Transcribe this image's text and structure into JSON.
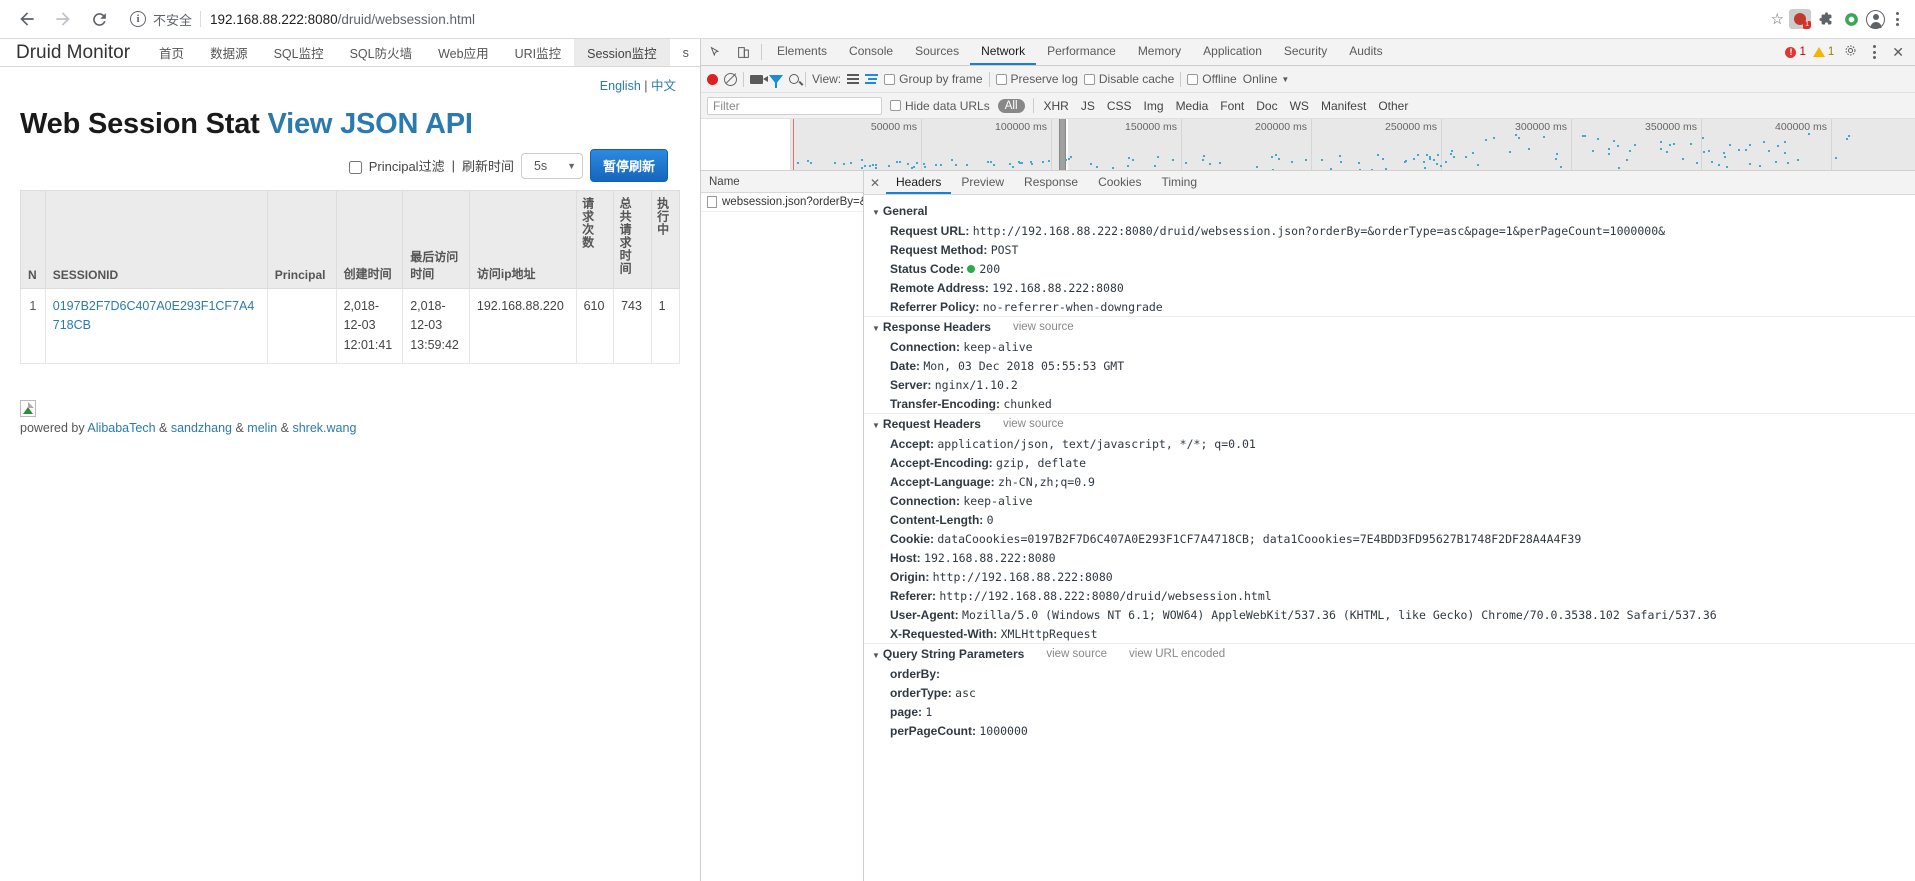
{
  "browser": {
    "back_icon": "back-arrow-icon",
    "forward_icon": "forward-arrow-icon",
    "reload_icon": "reload-icon",
    "security_label": "不安全",
    "url_host": "192.168.88.222:8080",
    "url_path": "/druid/websession.html",
    "url_full": "192.168.88.222:8080/druid/websession.html",
    "star_glyph": "☆",
    "ext_badge_count": "1",
    "profile_icon": "avatar-icon",
    "menu_icon": "kebab-menu-icon"
  },
  "druid": {
    "brand": "Druid Monitor",
    "tabs": [
      {
        "label": "首页",
        "active": false
      },
      {
        "label": "数据源",
        "active": false
      },
      {
        "label": "SQL监控",
        "active": false
      },
      {
        "label": "SQL防火墙",
        "active": false
      },
      {
        "label": "Web应用",
        "active": false
      },
      {
        "label": "URI监控",
        "active": false
      },
      {
        "label": "Session监控",
        "active": true
      },
      {
        "label": "s",
        "active": false
      }
    ],
    "lang": {
      "english": "English",
      "sep": " | ",
      "chinese": "中文"
    },
    "title": "Web Session Stat",
    "title_link": "View JSON API",
    "controls": {
      "principal_filter": "Principal过滤",
      "sep": "|",
      "refresh_label": "刷新时间",
      "refresh_value": "5s",
      "caret": "▼",
      "pause_button": "暂停刷新"
    },
    "table": {
      "headers": [
        "N",
        "SESSIONID",
        "Principal",
        "创建时间",
        "最后访问时间",
        "访问ip地址",
        "请求次数",
        "总共请求时间",
        "执行中"
      ],
      "rows": [
        {
          "n": "1",
          "sessionid": "0197B2F7D6C407A0E293F1CF7A4718CB",
          "principal": "",
          "create_time": "2,018-12-03 12:01:41",
          "last_access": "2,018-12-03 13:59:42",
          "ip": "192.168.88.220",
          "req_count": "610",
          "req_time": "743",
          "running": "1"
        }
      ]
    },
    "footer": {
      "powered_by": "powered by ",
      "links": [
        "AlibabaTech",
        "sandzhang",
        "melin",
        "shrek.wang"
      ],
      "amp": " & "
    }
  },
  "devtools": {
    "inspect_icon": "inspect-element-icon",
    "device_icon": "device-toolbar-icon",
    "tabs": [
      {
        "label": "Elements",
        "active": false
      },
      {
        "label": "Console",
        "active": false
      },
      {
        "label": "Sources",
        "active": false
      },
      {
        "label": "Network",
        "active": true
      },
      {
        "label": "Performance",
        "active": false
      },
      {
        "label": "Memory",
        "active": false
      },
      {
        "label": "Application",
        "active": false
      },
      {
        "label": "Security",
        "active": false
      },
      {
        "label": "Audits",
        "active": false
      }
    ],
    "error_count": "1",
    "warning_count": "1",
    "settings_icon": "gear-icon",
    "more_icon": "kebab-menu-icon",
    "close_icon": "close-icon",
    "toolbar": {
      "record_icon": "record-button-icon",
      "clear_icon": "clear-icon",
      "camera_icon": "capture-screenshots-icon",
      "filter_icon": "filter-funnel-icon",
      "search_icon": "search-icon",
      "view_label": "View:",
      "list_view_icon": "list-view-icon",
      "waterfall_view_icon": "waterfall-view-icon",
      "group_by_frame": "Group by frame",
      "preserve_log": "Preserve log",
      "disable_cache": "Disable cache",
      "offline": "Offline",
      "throttling": "Online",
      "throttle_caret": "▼"
    },
    "filterbar": {
      "filter_placeholder": "Filter",
      "hide_data_urls": "Hide data URLs",
      "all_pill": "All",
      "types": [
        "XHR",
        "JS",
        "CSS",
        "Img",
        "Media",
        "Font",
        "Doc",
        "WS",
        "Manifest",
        "Other"
      ]
    },
    "overview": {
      "ticks": [
        "50000 ms",
        "100000 ms",
        "150000 ms",
        "200000 ms",
        "250000 ms",
        "300000 ms",
        "350000 ms",
        "400000 ms"
      ]
    },
    "requests": {
      "column_header": "Name",
      "items": [
        {
          "name": "websession.json?orderBy=&or...",
          "icon": "document-icon"
        }
      ]
    },
    "detail_tabs": [
      {
        "label": "Headers",
        "active": true
      },
      {
        "label": "Preview",
        "active": false
      },
      {
        "label": "Response",
        "active": false
      },
      {
        "label": "Cookies",
        "active": false
      },
      {
        "label": "Timing",
        "active": false
      }
    ],
    "headers": {
      "general": {
        "title": "General",
        "rows": [
          {
            "key": "Request URL:",
            "value": "http://192.168.88.222:8080/druid/websession.json?orderBy=&orderType=asc&page=1&perPageCount=1000000&"
          },
          {
            "key": "Request Method:",
            "value": "POST"
          },
          {
            "key": "Status Code:",
            "value": "200",
            "status": true
          },
          {
            "key": "Remote Address:",
            "value": "192.168.88.222:8080"
          },
          {
            "key": "Referrer Policy:",
            "value": "no-referrer-when-downgrade"
          }
        ]
      },
      "response": {
        "title": "Response Headers",
        "view_source": "view source",
        "rows": [
          {
            "key": "Connection:",
            "value": "keep-alive"
          },
          {
            "key": "Date:",
            "value": "Mon, 03 Dec 2018 05:55:53 GMT"
          },
          {
            "key": "Server:",
            "value": "nginx/1.10.2"
          },
          {
            "key": "Transfer-Encoding:",
            "value": "chunked"
          }
        ]
      },
      "request": {
        "title": "Request Headers",
        "view_source": "view source",
        "rows": [
          {
            "key": "Accept:",
            "value": "application/json, text/javascript, */*; q=0.01"
          },
          {
            "key": "Accept-Encoding:",
            "value": "gzip, deflate"
          },
          {
            "key": "Accept-Language:",
            "value": "zh-CN,zh;q=0.9"
          },
          {
            "key": "Connection:",
            "value": "keep-alive"
          },
          {
            "key": "Content-Length:",
            "value": "0"
          },
          {
            "key": "Cookie:",
            "value": "dataCoookies=0197B2F7D6C407A0E293F1CF7A4718CB; data1Coookies=7E4BDD3FD95627B1748F2DF28A4A4F39"
          },
          {
            "key": "Host:",
            "value": "192.168.88.222:8080"
          },
          {
            "key": "Origin:",
            "value": "http://192.168.88.222:8080"
          },
          {
            "key": "Referer:",
            "value": "http://192.168.88.222:8080/druid/websession.html"
          },
          {
            "key": "User-Agent:",
            "value": "Mozilla/5.0 (Windows NT 6.1; WOW64) AppleWebKit/537.36 (KHTML, like Gecko) Chrome/70.0.3538.102 Safari/537.36"
          },
          {
            "key": "X-Requested-With:",
            "value": "XMLHttpRequest"
          }
        ]
      },
      "query": {
        "title": "Query String Parameters",
        "view_source": "view source",
        "view_url_encoded": "view URL encoded",
        "rows": [
          {
            "key": "orderBy:",
            "value": ""
          },
          {
            "key": "orderType:",
            "value": "asc"
          },
          {
            "key": "page:",
            "value": "1"
          },
          {
            "key": "perPageCount:",
            "value": "1000000"
          }
        ]
      }
    }
  }
}
